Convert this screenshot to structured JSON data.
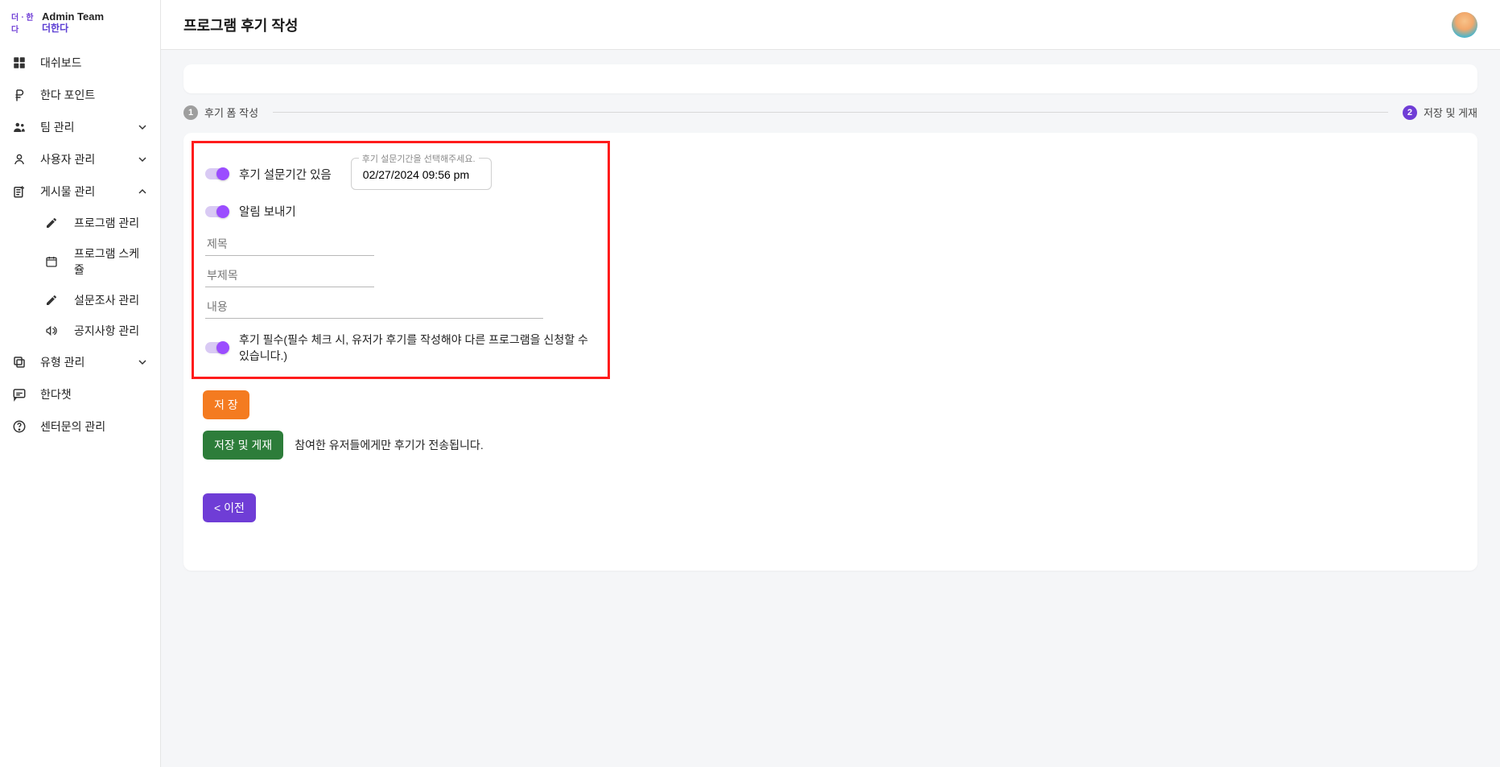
{
  "brand": {
    "admin_team": "Admin Team",
    "name": "더한다",
    "mark_text": "더ㆍ한다"
  },
  "sidebar": {
    "dashboard": "대쉬보드",
    "points": "한다 포인트",
    "team_mgmt": "팀 관리",
    "user_mgmt": "사용자 관리",
    "post_mgmt": "게시물 관리",
    "post_children": {
      "program_mgmt": "프로그램 관리",
      "program_schedule": "프로그램 스케쥴",
      "survey_mgmt": "설문조사 관리",
      "notice_mgmt": "공지사항 관리"
    },
    "type_mgmt": "유형 관리",
    "handa_chat": "한다챗",
    "center_inquiry": "센터문의 관리"
  },
  "page": {
    "title": "프로그램 후기 작성"
  },
  "stepper": {
    "step1_num": "1",
    "step1_label": "후기 폼 작성",
    "step2_num": "2",
    "step2_label": "저장 및 게재"
  },
  "form": {
    "toggle_period_label": "후기 설문기간 있음",
    "date_float_label": "후기 설문기간을 선택해주세요.",
    "date_value": "02/27/2024 09:56 pm",
    "toggle_notify_label": "알림 보내기",
    "title_placeholder": "제목",
    "subtitle_placeholder": "부제목",
    "content_placeholder": "내용",
    "toggle_required_label": "후기 필수(필수 체크 시, 유저가 후기를 작성해야 다른 프로그램을 신청할 수 있습니다.)"
  },
  "buttons": {
    "save": "저 장",
    "save_publish": "저장 및 게재",
    "publish_hint": "참여한 유저들에게만 후기가 전송됩니다.",
    "back": "< 이전"
  }
}
